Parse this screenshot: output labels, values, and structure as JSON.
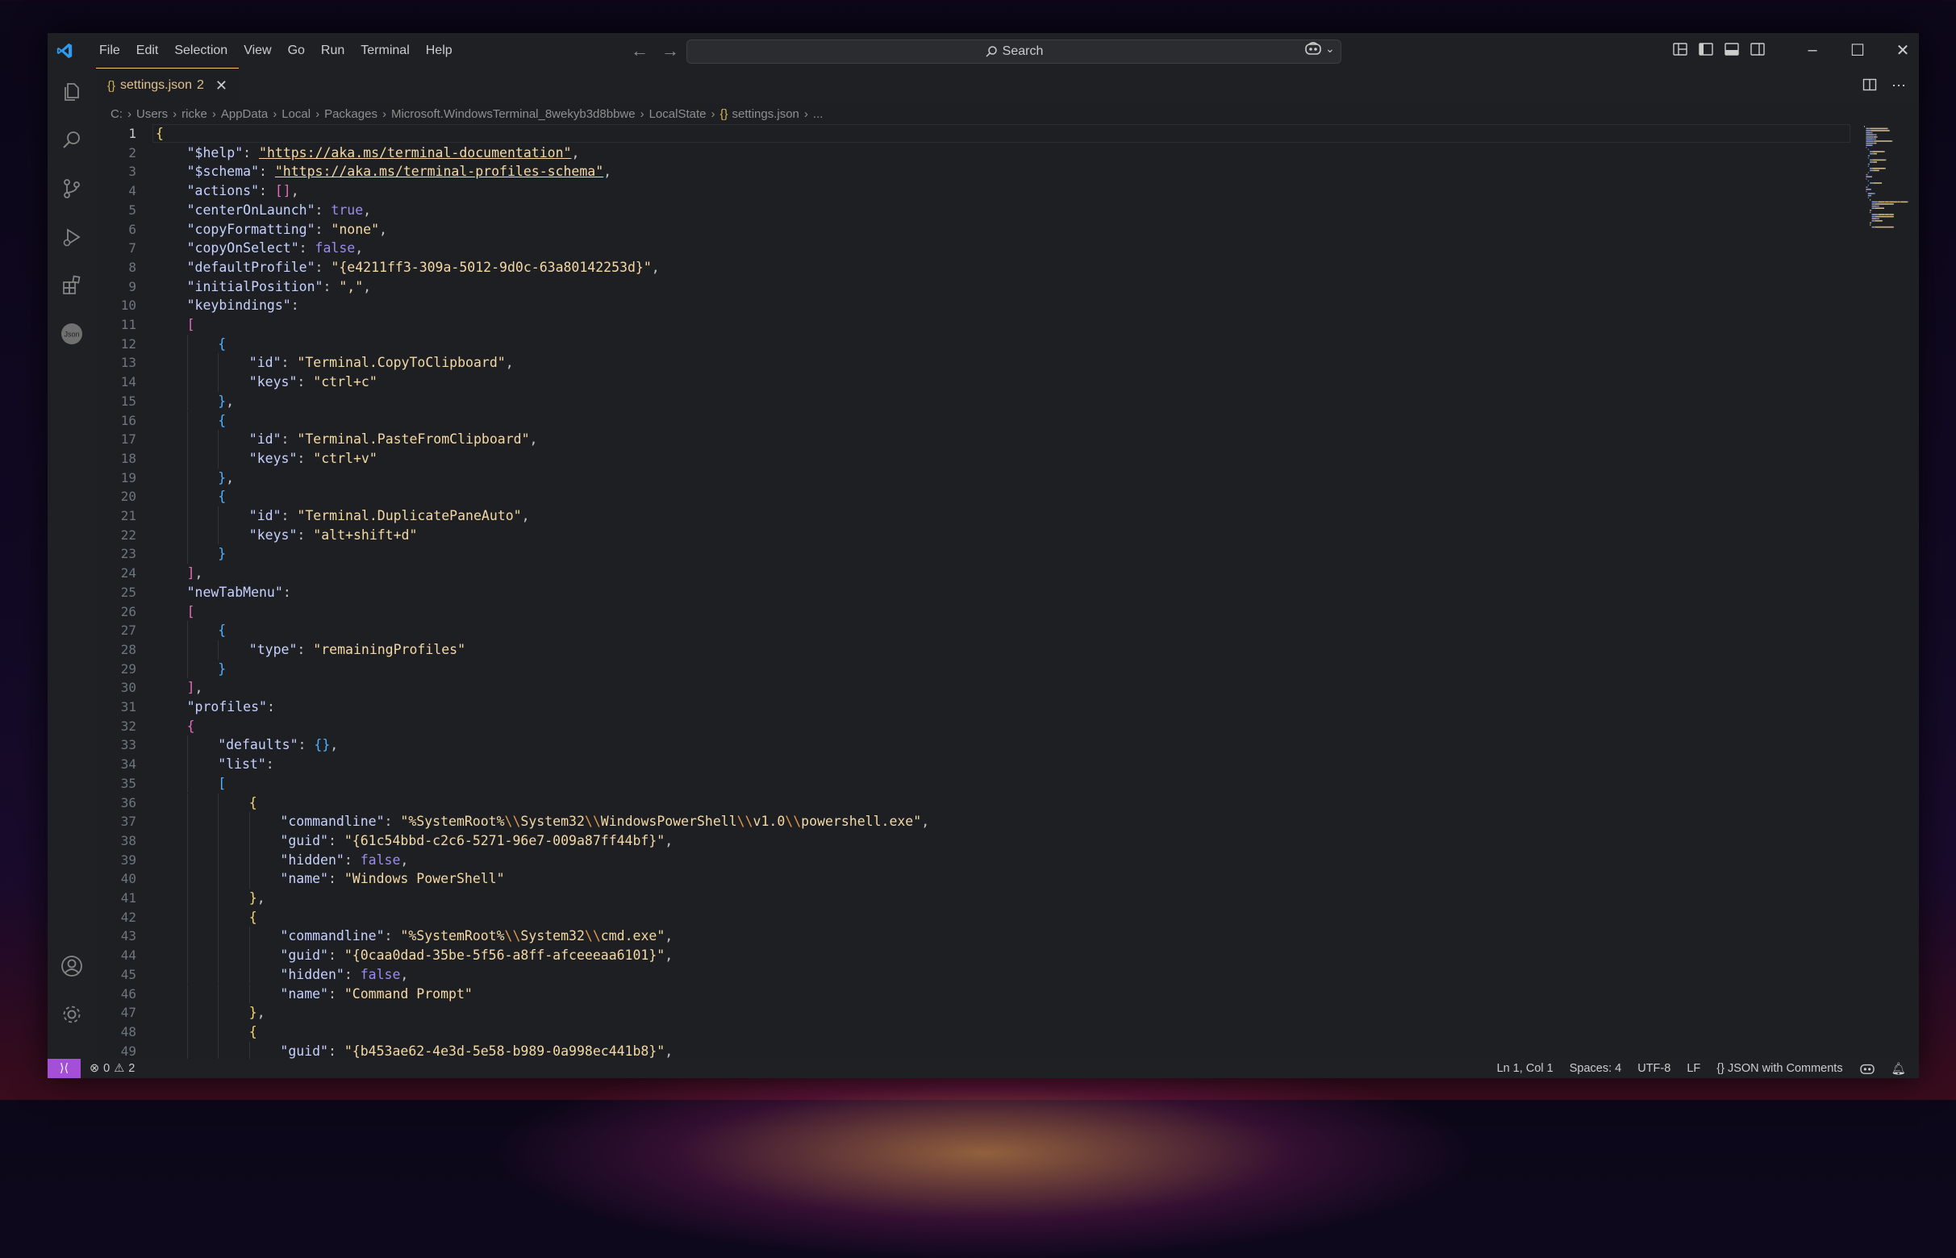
{
  "titlebar": {
    "menus": [
      "File",
      "Edit",
      "Selection",
      "View",
      "Go",
      "Run",
      "Terminal",
      "Help"
    ],
    "search_label": "Search"
  },
  "tab": {
    "name": "settings.json",
    "badge": "2",
    "icon": "{}"
  },
  "breadcrumbs": [
    "C:",
    "Users",
    "ricke",
    "AppData",
    "Local",
    "Packages",
    "Microsoft.WindowsTerminal_8wekyb3d8bbwe",
    "LocalState",
    "settings.json",
    "..."
  ],
  "editor": {
    "active_line": 1,
    "lines": [
      {
        "n": 1,
        "indent": 0,
        "t": [
          [
            "b1",
            "{"
          ]
        ]
      },
      {
        "n": 2,
        "indent": 1,
        "t": [
          [
            "k",
            "\"$help\""
          ],
          [
            "p",
            ": "
          ],
          [
            "su",
            "\"https://aka.ms/terminal-documentation\""
          ],
          [
            "p",
            ","
          ]
        ]
      },
      {
        "n": 3,
        "indent": 1,
        "t": [
          [
            "k",
            "\"$schema\""
          ],
          [
            "p",
            ": "
          ],
          [
            "su",
            "\"https://aka.ms/terminal-profiles-schema\""
          ],
          [
            "p",
            ","
          ]
        ]
      },
      {
        "n": 4,
        "indent": 1,
        "t": [
          [
            "k",
            "\"actions\""
          ],
          [
            "p",
            ": "
          ],
          [
            "b2",
            "[]"
          ],
          [
            "p",
            ","
          ]
        ]
      },
      {
        "n": 5,
        "indent": 1,
        "t": [
          [
            "k",
            "\"centerOnLaunch\""
          ],
          [
            "p",
            ": "
          ],
          [
            "kw",
            "true"
          ],
          [
            "p",
            ","
          ]
        ]
      },
      {
        "n": 6,
        "indent": 1,
        "t": [
          [
            "k",
            "\"copyFormatting\""
          ],
          [
            "p",
            ": "
          ],
          [
            "s",
            "\"none\""
          ],
          [
            "p",
            ","
          ]
        ]
      },
      {
        "n": 7,
        "indent": 1,
        "t": [
          [
            "k",
            "\"copyOnSelect\""
          ],
          [
            "p",
            ": "
          ],
          [
            "kw",
            "false"
          ],
          [
            "p",
            ","
          ]
        ]
      },
      {
        "n": 8,
        "indent": 1,
        "t": [
          [
            "k",
            "\"defaultProfile\""
          ],
          [
            "p",
            ": "
          ],
          [
            "s",
            "\"{e4211ff3-309a-5012-9d0c-63a80142253d}\""
          ],
          [
            "p",
            ","
          ]
        ]
      },
      {
        "n": 9,
        "indent": 1,
        "t": [
          [
            "k",
            "\"initialPosition\""
          ],
          [
            "p",
            ": "
          ],
          [
            "s",
            "\",\""
          ],
          [
            "p",
            ","
          ]
        ]
      },
      {
        "n": 10,
        "indent": 1,
        "t": [
          [
            "k",
            "\"keybindings\""
          ],
          [
            "p",
            ":"
          ]
        ]
      },
      {
        "n": 11,
        "indent": 1,
        "t": [
          [
            "b2",
            "["
          ]
        ]
      },
      {
        "n": 12,
        "indent": 2,
        "t": [
          [
            "b3",
            "{"
          ]
        ]
      },
      {
        "n": 13,
        "indent": 3,
        "t": [
          [
            "k",
            "\"id\""
          ],
          [
            "p",
            ": "
          ],
          [
            "s",
            "\"Terminal.CopyToClipboard\""
          ],
          [
            "p",
            ","
          ]
        ]
      },
      {
        "n": 14,
        "indent": 3,
        "t": [
          [
            "k",
            "\"keys\""
          ],
          [
            "p",
            ": "
          ],
          [
            "s",
            "\"ctrl+c\""
          ]
        ]
      },
      {
        "n": 15,
        "indent": 2,
        "t": [
          [
            "b3",
            "}"
          ],
          [
            "p",
            ","
          ]
        ]
      },
      {
        "n": 16,
        "indent": 2,
        "t": [
          [
            "b3",
            "{"
          ]
        ]
      },
      {
        "n": 17,
        "indent": 3,
        "t": [
          [
            "k",
            "\"id\""
          ],
          [
            "p",
            ": "
          ],
          [
            "s",
            "\"Terminal.PasteFromClipboard\""
          ],
          [
            "p",
            ","
          ]
        ]
      },
      {
        "n": 18,
        "indent": 3,
        "t": [
          [
            "k",
            "\"keys\""
          ],
          [
            "p",
            ": "
          ],
          [
            "s",
            "\"ctrl+v\""
          ]
        ]
      },
      {
        "n": 19,
        "indent": 2,
        "t": [
          [
            "b3",
            "}"
          ],
          [
            "p",
            ","
          ]
        ]
      },
      {
        "n": 20,
        "indent": 2,
        "t": [
          [
            "b3",
            "{"
          ]
        ]
      },
      {
        "n": 21,
        "indent": 3,
        "t": [
          [
            "k",
            "\"id\""
          ],
          [
            "p",
            ": "
          ],
          [
            "s",
            "\"Terminal.DuplicatePaneAuto\""
          ],
          [
            "p",
            ","
          ]
        ]
      },
      {
        "n": 22,
        "indent": 3,
        "t": [
          [
            "k",
            "\"keys\""
          ],
          [
            "p",
            ": "
          ],
          [
            "s",
            "\"alt+shift+d\""
          ]
        ]
      },
      {
        "n": 23,
        "indent": 2,
        "t": [
          [
            "b3",
            "}"
          ]
        ]
      },
      {
        "n": 24,
        "indent": 1,
        "t": [
          [
            "b2",
            "]"
          ],
          [
            "p",
            ","
          ]
        ]
      },
      {
        "n": 25,
        "indent": 1,
        "t": [
          [
            "k",
            "\"newTabMenu\""
          ],
          [
            "p",
            ":"
          ]
        ]
      },
      {
        "n": 26,
        "indent": 1,
        "t": [
          [
            "b2",
            "["
          ]
        ]
      },
      {
        "n": 27,
        "indent": 2,
        "t": [
          [
            "b3",
            "{"
          ]
        ]
      },
      {
        "n": 28,
        "indent": 3,
        "t": [
          [
            "k",
            "\"type\""
          ],
          [
            "p",
            ": "
          ],
          [
            "s",
            "\"remainingProfiles\""
          ]
        ]
      },
      {
        "n": 29,
        "indent": 2,
        "t": [
          [
            "b3",
            "}"
          ]
        ]
      },
      {
        "n": 30,
        "indent": 1,
        "t": [
          [
            "b2",
            "]"
          ],
          [
            "p",
            ","
          ]
        ]
      },
      {
        "n": 31,
        "indent": 1,
        "t": [
          [
            "k",
            "\"profiles\""
          ],
          [
            "p",
            ":"
          ]
        ]
      },
      {
        "n": 32,
        "indent": 1,
        "t": [
          [
            "b2",
            "{"
          ]
        ]
      },
      {
        "n": 33,
        "indent": 2,
        "t": [
          [
            "k",
            "\"defaults\""
          ],
          [
            "p",
            ": "
          ],
          [
            "b3",
            "{}"
          ],
          [
            "p",
            ","
          ]
        ]
      },
      {
        "n": 34,
        "indent": 2,
        "t": [
          [
            "k",
            "\"list\""
          ],
          [
            "p",
            ":"
          ]
        ]
      },
      {
        "n": 35,
        "indent": 2,
        "t": [
          [
            "b3",
            "["
          ]
        ]
      },
      {
        "n": 36,
        "indent": 3,
        "t": [
          [
            "b1",
            "{"
          ]
        ]
      },
      {
        "n": 37,
        "indent": 4,
        "t": [
          [
            "k",
            "\"commandline\""
          ],
          [
            "p",
            ": "
          ],
          [
            "s",
            "\"%SystemRoot%"
          ],
          [
            "esc",
            "\\\\"
          ],
          [
            "s",
            "System32"
          ],
          [
            "esc",
            "\\\\"
          ],
          [
            "s",
            "WindowsPowerShell"
          ],
          [
            "esc",
            "\\\\"
          ],
          [
            "s",
            "v1.0"
          ],
          [
            "esc",
            "\\\\"
          ],
          [
            "s",
            "powershell.exe\""
          ],
          [
            "p",
            ","
          ]
        ]
      },
      {
        "n": 38,
        "indent": 4,
        "t": [
          [
            "k",
            "\"guid\""
          ],
          [
            "p",
            ": "
          ],
          [
            "s",
            "\"{61c54bbd-c2c6-5271-96e7-009a87ff44bf}\""
          ],
          [
            "p",
            ","
          ]
        ]
      },
      {
        "n": 39,
        "indent": 4,
        "t": [
          [
            "k",
            "\"hidden\""
          ],
          [
            "p",
            ": "
          ],
          [
            "kw",
            "false"
          ],
          [
            "p",
            ","
          ]
        ]
      },
      {
        "n": 40,
        "indent": 4,
        "t": [
          [
            "k",
            "\"name\""
          ],
          [
            "p",
            ": "
          ],
          [
            "s",
            "\"Windows PowerShell\""
          ]
        ]
      },
      {
        "n": 41,
        "indent": 3,
        "t": [
          [
            "b1",
            "}"
          ],
          [
            "p",
            ","
          ]
        ]
      },
      {
        "n": 42,
        "indent": 3,
        "t": [
          [
            "b1",
            "{"
          ]
        ]
      },
      {
        "n": 43,
        "indent": 4,
        "t": [
          [
            "k",
            "\"commandline\""
          ],
          [
            "p",
            ": "
          ],
          [
            "s",
            "\"%SystemRoot%"
          ],
          [
            "esc",
            "\\\\"
          ],
          [
            "s",
            "System32"
          ],
          [
            "esc",
            "\\\\"
          ],
          [
            "s",
            "cmd.exe\""
          ],
          [
            "p",
            ","
          ]
        ]
      },
      {
        "n": 44,
        "indent": 4,
        "t": [
          [
            "k",
            "\"guid\""
          ],
          [
            "p",
            ": "
          ],
          [
            "s",
            "\"{0caa0dad-35be-5f56-a8ff-afceeeaa6101}\""
          ],
          [
            "p",
            ","
          ]
        ]
      },
      {
        "n": 45,
        "indent": 4,
        "t": [
          [
            "k",
            "\"hidden\""
          ],
          [
            "p",
            ": "
          ],
          [
            "kw",
            "false"
          ],
          [
            "p",
            ","
          ]
        ]
      },
      {
        "n": 46,
        "indent": 4,
        "t": [
          [
            "k",
            "\"name\""
          ],
          [
            "p",
            ": "
          ],
          [
            "s",
            "\"Command Prompt\""
          ]
        ]
      },
      {
        "n": 47,
        "indent": 3,
        "t": [
          [
            "b1",
            "}"
          ],
          [
            "p",
            ","
          ]
        ]
      },
      {
        "n": 48,
        "indent": 3,
        "t": [
          [
            "b1",
            "{"
          ]
        ]
      },
      {
        "n": 49,
        "indent": 4,
        "t": [
          [
            "k",
            "\"guid\""
          ],
          [
            "p",
            ": "
          ],
          [
            "s",
            "\"{b453ae62-4e3d-5e58-b989-0a998ec441b8}\""
          ],
          [
            "p",
            ","
          ]
        ]
      }
    ]
  },
  "statusbar": {
    "errors": "0",
    "warnings": "2",
    "position": "Ln 1, Col 1",
    "spaces": "Spaces: 4",
    "encoding": "UTF-8",
    "eol": "LF",
    "language": "JSON with Comments",
    "language_icon": "{}"
  },
  "icons": {
    "activity_bar": [
      "explorer-icon",
      "search-icon",
      "source-control-icon",
      "run-debug-icon",
      "extensions-icon",
      "json-icon",
      "account-icon",
      "settings-gear-icon"
    ]
  },
  "colors": {
    "accent": "#a54fd9",
    "tab_modified": "#e2c08d",
    "editor_bg": "#1e1f22"
  }
}
